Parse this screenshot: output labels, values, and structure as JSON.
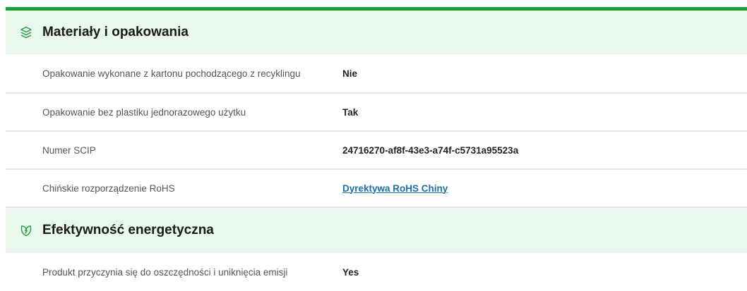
{
  "colors": {
    "accent": "#1e9e3a",
    "header_bg": "#e8f8ec",
    "link": "#1a6fa8"
  },
  "sections": [
    {
      "icon": "layers-icon",
      "title": "Materiały i opakowania",
      "rows": [
        {
          "label": "Opakowanie wykonane z kartonu pochodzącego z recyklingu",
          "value": "Nie"
        },
        {
          "label": "Opakowanie bez plastiku jednorazowego użytku",
          "value": "Tak"
        },
        {
          "label": "Numer SCIP",
          "value": "24716270-af8f-43e3-a74f-c5731a95523a"
        },
        {
          "label": "Chińskie rozporządzenie RoHS",
          "value": "Dyrektywa RoHS Chiny"
        }
      ]
    },
    {
      "icon": "energy-leaf-icon",
      "title": "Efektywność energetyczna",
      "rows": [
        {
          "label": "Produkt przyczynia się do oszczędności i uniknięcia emisji",
          "value": "Yes"
        }
      ]
    }
  ]
}
